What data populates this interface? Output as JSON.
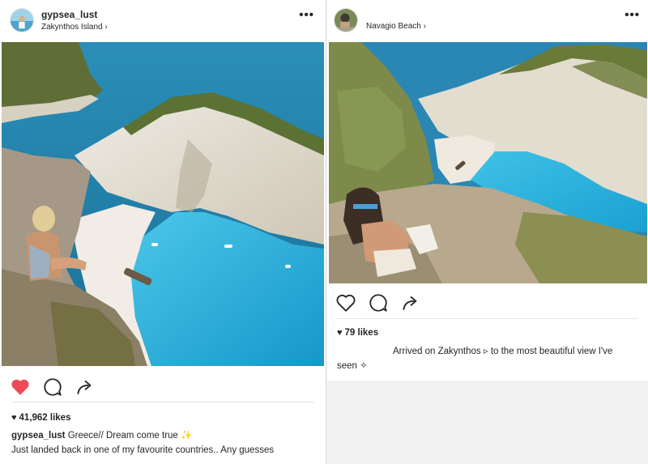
{
  "left_post": {
    "username": "gypsea_lust",
    "location": "Zakynthos Island",
    "location_chevron": "›",
    "more_label": "•••",
    "liked": true,
    "heart_color": "#ed4956",
    "likes_heart": "♥",
    "likes": "41,962 likes",
    "caption_user": "gypsea_lust",
    "caption_line1": "Greece// Dream come true",
    "caption_sparkle": "✨",
    "caption_line2": "Just landed back in one of my favourite countries.. Any guesses"
  },
  "right_post": {
    "location": "Navagio Beach",
    "location_chevron": "›",
    "more_label": "•••",
    "liked": false,
    "likes_heart": "♥",
    "likes": "79 likes",
    "caption_line1": "Arrived on Zakynthos ▹ to the most beautiful view I've",
    "caption_line2": "seen ✧"
  },
  "icons": {
    "like": "heart-icon",
    "comment": "comment-icon",
    "share": "share-icon",
    "more": "more-options-icon"
  },
  "colors": {
    "sea": "#1fa9d6",
    "cliff": "#e6e1d6",
    "vegetation": "#6b7a3a"
  }
}
